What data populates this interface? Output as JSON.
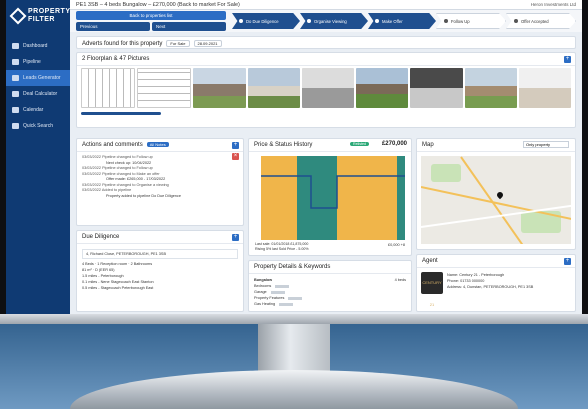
{
  "app": {
    "logo_line1": "PROPERTY",
    "logo_line2": "FILTER"
  },
  "topbar": {
    "title": "PE1 3SB – 4 beds Bungalow – £270,000 (Back to market For Sale)",
    "user": "Heron Investments Ltd"
  },
  "sidebar": {
    "items": [
      {
        "label": "Dashboard",
        "icon": "dashboard-icon"
      },
      {
        "label": "Pipeline",
        "icon": "pipeline-icon"
      },
      {
        "label": "Leads Generator",
        "icon": "leads-icon"
      },
      {
        "label": "Deal Calculator",
        "icon": "calculator-icon"
      },
      {
        "label": "Calendar",
        "icon": "calendar-icon"
      },
      {
        "label": "Quick Search",
        "icon": "search-icon"
      }
    ]
  },
  "subbar": {
    "back": "Back to properties list",
    "previous": "Previous",
    "next": "Next",
    "steps": [
      {
        "label": "Do Due Diligence",
        "done": true
      },
      {
        "label": "Organise Viewing",
        "done": true
      },
      {
        "label": "Make Offer",
        "done": true
      },
      {
        "label": "Follow Up",
        "done": false
      },
      {
        "label": "Offer Accepted",
        "done": false
      }
    ]
  },
  "adverts": {
    "title": "Adverts found for this property",
    "source": "For Sale",
    "date": "28.09.2021"
  },
  "pictures": {
    "title": "2 Floorplan & 47 Pictures"
  },
  "actions": {
    "title": "Actions and comments",
    "filter": "All Notes",
    "entries": [
      {
        "date": "03/03/2022",
        "text": "Pipeline changed to Follow up",
        "sub": "Next check up: 10/04/2022"
      },
      {
        "date": "03/03/2022",
        "text": "Pipeline changed to Follow up",
        "sub": ""
      },
      {
        "date": "03/03/2022",
        "text": "Pipeline changed to Make an offer",
        "sub": "Offer made: £265,000 - 17/03/2022"
      },
      {
        "date": "03/03/2022",
        "text": "Pipeline changed to Organise a viewing",
        "sub": ""
      },
      {
        "date": "03/03/2022",
        "text": "Added to pipeline",
        "sub": "Property added to pipeline Do Due Diligence"
      }
    ]
  },
  "price": {
    "title": "Price & Status History",
    "status": "Relisted",
    "value": "£270,000",
    "last_sold": "Last sale: 01/01/2018 £1,875,000",
    "note": "Rising 5% last Sold Price - 5.00%",
    "amount": "£0,000 +8"
  },
  "chart_data": {
    "type": "bar",
    "bands": [
      {
        "status": "For Sale",
        "color": "#f0b54a"
      },
      {
        "status": "Under Offer",
        "color": "#2f8a7e"
      },
      {
        "status": "For Sale",
        "color": "#f0b54a"
      },
      {
        "status": "Under Offer",
        "color": "#2f8a7e"
      }
    ]
  },
  "map": {
    "title": "Map",
    "select": "Only property"
  },
  "due": {
    "title": "Due Diligence",
    "address": "4, Richard Close, PETERBOROUGH, PE1 3SB",
    "beds": "4 Beds",
    "reception": "1 Reception room",
    "bath": "2 Bathrooms",
    "area": "81 m²",
    "epc": "D (EER 65)",
    "schools": [
      "1.5 miles - Peterborough",
      "0.1 miles - Nene Stagecoach East Stanton",
      "0.5 miles - Stagecoach Peterborough East"
    ]
  },
  "details": {
    "title": "Property Details & Keywords",
    "rows": [
      "Bungalow",
      "Bedrooms",
      "Garage",
      "Property Features",
      "Gas Heating"
    ],
    "keywords_count": "4 beds"
  },
  "agent": {
    "title": "Agent",
    "name": "Name: Century 21 - Peterborough",
    "phone": "Phone: 01733 000000",
    "address": "Address: 4, Dunstan, PETERBOROUGH, PE1 3SB",
    "logo": "CENTURY 21"
  }
}
